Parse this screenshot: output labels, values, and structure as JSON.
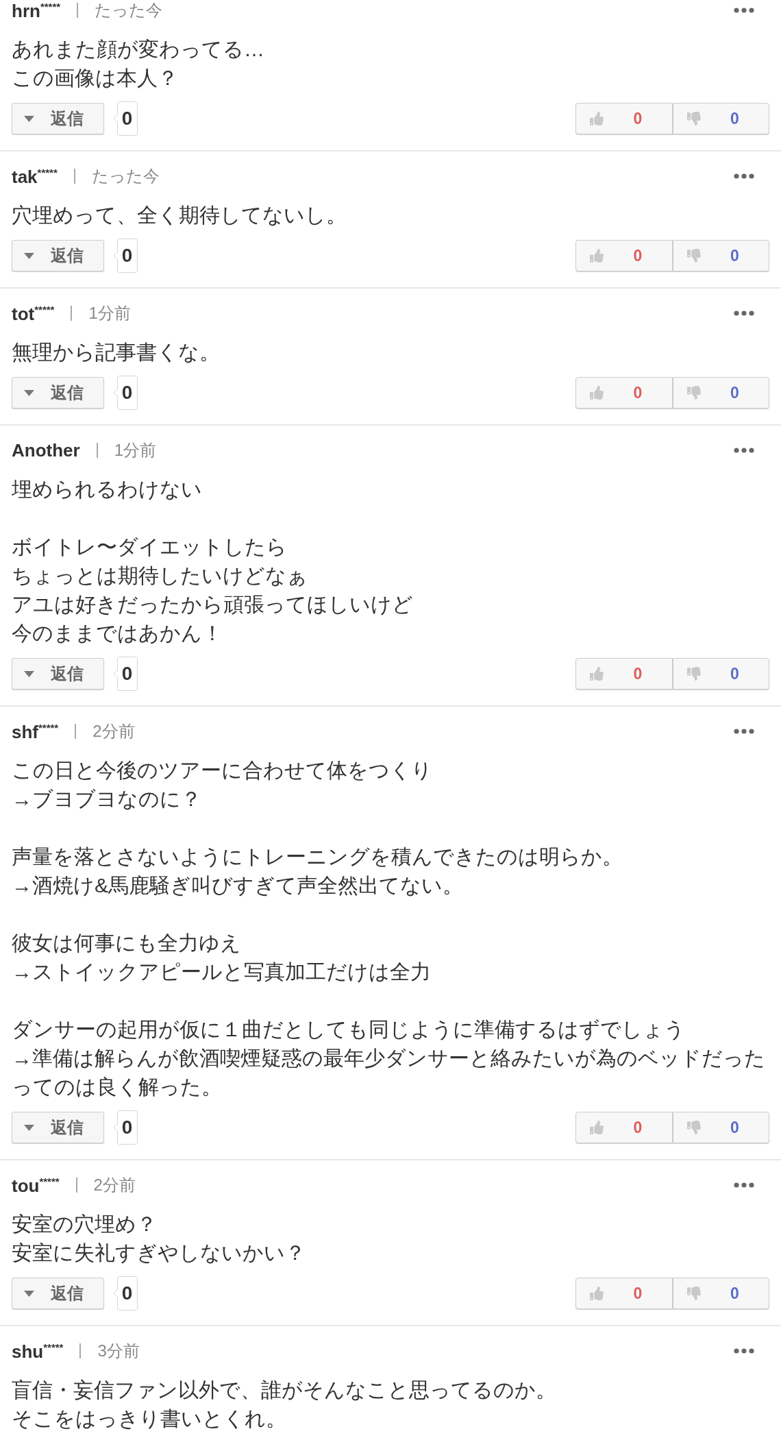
{
  "comments": [
    {
      "user": "hrn",
      "mask": "*****",
      "time": "たった今",
      "paragraphs": [
        [
          "あれまた顔が変わってる…",
          "この画像は本人？"
        ]
      ],
      "reply": {
        "label": "返信",
        "count": "0"
      },
      "votes": {
        "up": "0",
        "down": "0"
      }
    },
    {
      "user": "tak",
      "mask": "*****",
      "time": "たった今",
      "paragraphs": [
        [
          "穴埋めって、全く期待してないし。"
        ]
      ],
      "reply": {
        "label": "返信",
        "count": "0"
      },
      "votes": {
        "up": "0",
        "down": "0"
      }
    },
    {
      "user": "tot",
      "mask": "*****",
      "time": "1分前",
      "paragraphs": [
        [
          "無理から記事書くな。"
        ]
      ],
      "reply": {
        "label": "返信",
        "count": "0"
      },
      "votes": {
        "up": "0",
        "down": "0"
      }
    },
    {
      "user": "Another",
      "time": "1分前",
      "paragraphs": [
        [
          "埋められるわけない"
        ],
        [
          "ボイトレ〜ダイエットしたら",
          "ちょっとは期待したいけどなぁ",
          "アユは好きだったから頑張ってほしいけど",
          "今のままではあかん！"
        ]
      ],
      "reply": {
        "label": "返信",
        "count": "0"
      },
      "votes": {
        "up": "0",
        "down": "0"
      }
    },
    {
      "user": "shf",
      "mask": "*****",
      "time": "2分前",
      "paragraphs": [
        [
          "この日と今後のツアーに合わせて体をつくり",
          "→ブヨブヨなのに？"
        ],
        [
          "声量を落とさないようにトレーニングを積んできたのは明らか。",
          "→酒焼け&馬鹿騒ぎ叫びすぎて声全然出てない。"
        ],
        [
          "彼女は何事にも全力ゆえ",
          "→ストイックアピールと写真加工だけは全力"
        ],
        [
          "ダンサーの起用が仮に１曲だとしても同じように準備するはずでしょう",
          "→準備は解らんが飲酒喫煙疑惑の最年少ダンサーと絡みたいが為のベッドだったってのは良く解った。"
        ]
      ],
      "reply": {
        "label": "返信",
        "count": "0"
      },
      "votes": {
        "up": "0",
        "down": "0"
      }
    },
    {
      "user": "tou",
      "mask": "*****",
      "time": "2分前",
      "paragraphs": [
        [
          "安室の穴埋め？",
          "安室に失礼すぎやしないかい？"
        ]
      ],
      "reply": {
        "label": "返信",
        "count": "0"
      },
      "votes": {
        "up": "0",
        "down": "0"
      }
    },
    {
      "user": "shu",
      "mask": "*****",
      "time": "3分前",
      "paragraphs": [
        [
          "盲信・妄信ファン以外で、誰がそんなこと思ってるのか。",
          "そこをはっきり書いとくれ。"
        ]
      ]
    }
  ]
}
